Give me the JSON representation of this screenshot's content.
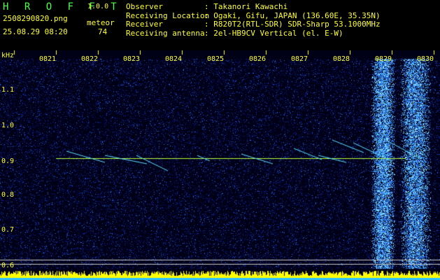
{
  "app": {
    "title": "H R O F F T",
    "version": "1.0.0"
  },
  "file": {
    "name": "2508290820.png",
    "datetime": "25.08.29 08:20"
  },
  "meteor": {
    "label": "meteor",
    "count": "74"
  },
  "station": {
    "rows": [
      {
        "key": "Observer",
        "value": ": Takanori Kawachi"
      },
      {
        "key": "Receiving Location",
        "value": ": Ogaki, Gifu, JAPAN (136.60E, 35.35N)"
      },
      {
        "key": "Receiver",
        "value": ": R820T2(RTL-SDR) SDR-Sharp 53.1000MHz"
      },
      {
        "key": "Receiving antenna",
        "value": ": 2el-HB9CV Vertical (el. E-W)"
      }
    ]
  },
  "spectrogram": {
    "unit": "kHz",
    "y_ticks": [
      "1.1",
      "1.0",
      "0.9",
      "0.8",
      "0.7",
      "0.6"
    ],
    "x_ticks": [
      "0821",
      "0822",
      "0823",
      "0824",
      "0825",
      "0826",
      "0827",
      "0828",
      "0829",
      "0830"
    ],
    "colors": {
      "text": "#ffff33",
      "title": "#4cff4c",
      "carrier": "#b8ff40",
      "noise_bar": "#ffff00"
    }
  }
}
